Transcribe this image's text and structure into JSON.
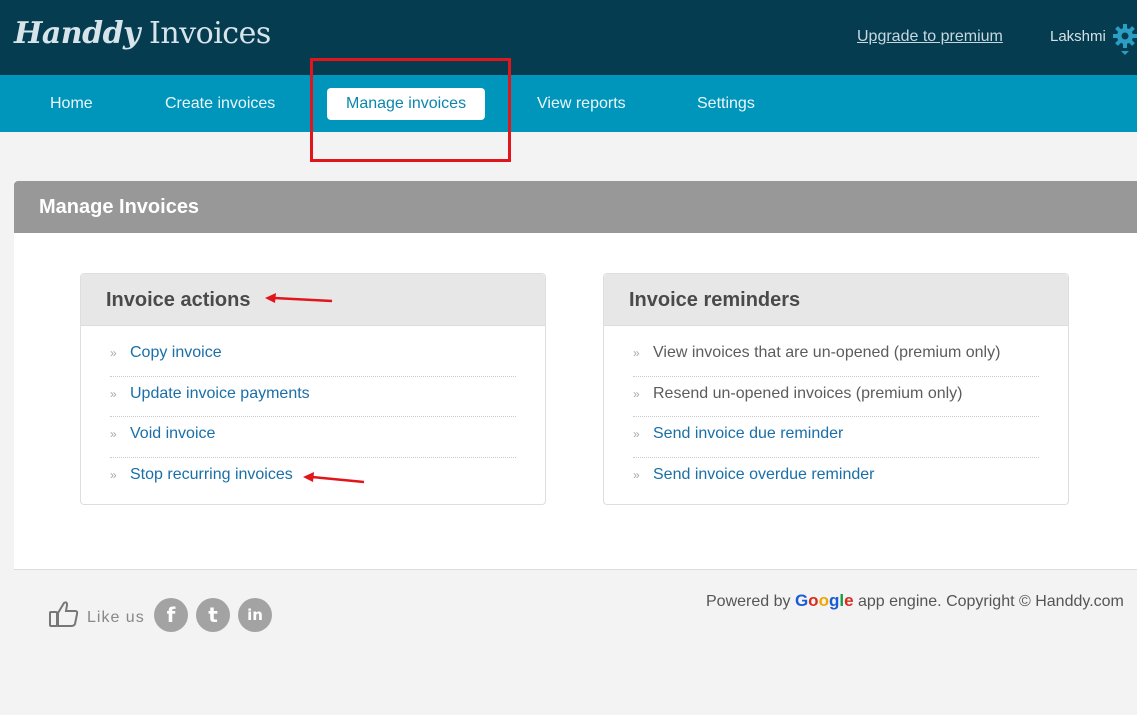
{
  "header": {
    "logo_script": "Handdy",
    "logo_text": " Invoices",
    "upgrade_link": "Upgrade to premium",
    "user_name": "Lakshmi"
  },
  "nav": {
    "items": [
      {
        "label": "Home"
      },
      {
        "label": "Create invoices"
      },
      {
        "label": "Manage invoices"
      },
      {
        "label": "View reports"
      },
      {
        "label": "Settings"
      }
    ]
  },
  "page": {
    "title": "Manage Invoices"
  },
  "cards": {
    "actions": {
      "title": "Invoice actions",
      "items": [
        {
          "label": "Copy invoice"
        },
        {
          "label": "Update invoice payments"
        },
        {
          "label": "Void invoice"
        },
        {
          "label": "Stop recurring invoices"
        }
      ]
    },
    "reminders": {
      "title": "Invoice reminders",
      "items": [
        {
          "label": "View invoices that are un-opened (premium only)"
        },
        {
          "label": "Resend un-opened invoices (premium only)"
        },
        {
          "label": "Send invoice due reminder"
        },
        {
          "label": "Send invoice overdue reminder"
        }
      ]
    }
  },
  "footer": {
    "like_text": "Like us",
    "social": [
      {
        "icon": "facebook-icon",
        "glyph": "f"
      },
      {
        "icon": "twitter-icon",
        "glyph": "t"
      },
      {
        "icon": "linkedin-icon",
        "glyph": "in"
      }
    ],
    "powered_prefix": "Powered by ",
    "powered_brand": "Google",
    "powered_suffix": " app engine. Copyright © Handdy.com"
  },
  "colors": {
    "header_bg": "#053c4f",
    "nav_bg": "#0096bb",
    "link": "#1a6fa8",
    "annotation_red": "#e0161c"
  }
}
